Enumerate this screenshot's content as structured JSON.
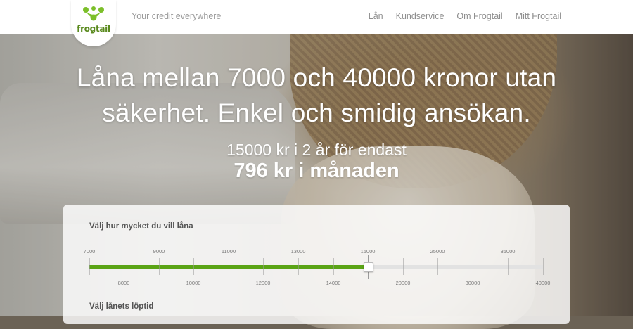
{
  "header": {
    "logo_text": "frogtail",
    "tagline": "Your credit everywhere",
    "nav": [
      "Lån",
      "Kundservice",
      "Om Frogtail",
      "Mitt Frogtail"
    ]
  },
  "hero": {
    "headline_line1": "Låna mellan 7000 och 40000 kronor utan",
    "headline_line2": "säkerhet. Enkel och smidig ansökan.",
    "offer_line": "15000 kr i 2 år för endast",
    "offer_amount": "796 kr i månaden"
  },
  "calculator": {
    "amount_label": "Välj hur mycket du vill låna",
    "period_label": "Välj lånets löptid",
    "scale_top": [
      "7000",
      "9000",
      "11000",
      "13000",
      "15000",
      "25000",
      "35000"
    ],
    "scale_bottom": [
      "8000",
      "10000",
      "12000",
      "14000",
      "20000",
      "30000",
      "40000"
    ],
    "selected_amount": 15000,
    "accent_color": "#5aa415"
  },
  "colors": {
    "brand_green": "#5a8a1e",
    "slider_fill": "#5aa415"
  }
}
